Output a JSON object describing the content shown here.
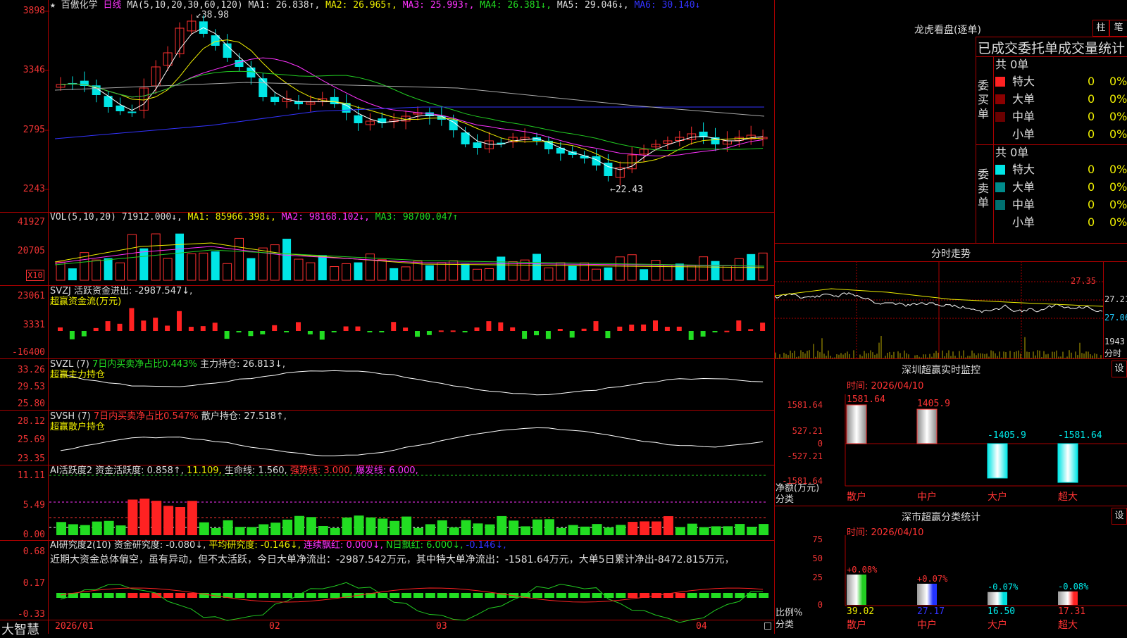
{
  "stock": {
    "star": "★",
    "name": "百傲化学",
    "period": "日线"
  },
  "colors": {
    "up": "#ff3030",
    "down": "#00e5e5",
    "vol_up": "#ff3030",
    "vol_down": "#00e5e5"
  },
  "ma_header": {
    "label": "MA(5,10,20,30,60,120)",
    "ma1": "MA1: 26.838↑,",
    "ma2": "MA2: 26.965↑,",
    "ma3": "MA3: 25.993↑,",
    "ma4": "MA4: 26.381↓,",
    "ma5": "MA5: 29.046↓,",
    "ma6": "MA6: 30.140↓"
  },
  "main_axis": [
    "3898",
    "3346",
    "2795",
    "2243"
  ],
  "annot": {
    "high": "38.98",
    "low": "22.43"
  },
  "vol": {
    "header_label": "VOL(5,10,20)",
    "value": "71912.000↓,",
    "ma1": "MA1: 85966.398↓,",
    "ma2": "MA2: 98168.102↓,",
    "ma3": "MA3: 98700.047↑",
    "axis": [
      "41927",
      "20705"
    ],
    "unit": "X10"
  },
  "svzj": {
    "header": "SVZJ  活跃资金进出: -2987.547↓,",
    "sub": "超赢资金流(万元)",
    "axis": [
      "23061",
      "3331",
      "-16400"
    ]
  },
  "svzl": {
    "header_a": "SVZL (7)",
    "header_b": "7日内买卖净占比0.443%",
    "header_c": "主力持仓: 26.813↓,",
    "sub": "超赢主力持仓",
    "axis": [
      "33.26",
      "29.53",
      "25.80"
    ]
  },
  "svsh": {
    "header_a": "SVSH (7)",
    "header_b": "7日内买卖净占比0.547%",
    "header_c": "散户持仓: 27.518↑,",
    "sub": "超赢散户持仓",
    "axis": [
      "28.12",
      "25.69",
      "23.35"
    ]
  },
  "ai1": {
    "header_a": "AI活跃度2",
    "header_b": "资金活跃度: 0.858↑,",
    "header_c": "11.109,",
    "header_d": "生命线: 1.560,",
    "header_e": "强势线: 3.000,",
    "header_f": "爆发线: 6.000,",
    "axis": [
      "11.11",
      "5.49",
      "0.00"
    ]
  },
  "ai2": {
    "header_a": "AI研究度2(10)",
    "header_b": "资金研究度: -0.080↓,",
    "header_c": "平均研究度: -0.146↓,",
    "header_d": "连续飘红: 0.000↓,",
    "header_e": "N日飘红: 6.000↓,",
    "header_f": "-0.146↓,",
    "comment": "近期大资金总体偏空，虽有异动，但不太活跃，今日大单净流出：-2987.542万元，其中特大单净流出：-1581.64万元，大单5日累计净出-8472.815万元，",
    "axis": [
      "0.68",
      "0.17",
      "-0.33"
    ]
  },
  "time_axis": [
    "2026/01",
    "02",
    "03",
    "04"
  ],
  "footer": {
    "brand": "大智慧"
  },
  "right": {
    "title": "龙虎看盘(逐单)",
    "btn_bar": "柱",
    "btn_pen": "笔",
    "stat_title": "已成交委托单成交量统计",
    "buy": {
      "label": "委买单",
      "total": "共 0单",
      "rows": [
        {
          "name": "特大",
          "v": "0",
          "p": "0%"
        },
        {
          "name": "大单",
          "v": "0",
          "p": "0%"
        },
        {
          "name": "中单",
          "v": "0",
          "p": "0%"
        },
        {
          "name": "小单",
          "v": "0",
          "p": "0%"
        }
      ]
    },
    "sell": {
      "label": "委卖单",
      "total": "共 0单",
      "rows": [
        {
          "name": "特大",
          "v": "0",
          "p": "0%"
        },
        {
          "name": "大单",
          "v": "0",
          "p": "0%"
        },
        {
          "name": "中单",
          "v": "0",
          "p": "0%"
        },
        {
          "name": "小单",
          "v": "0",
          "p": "0%"
        }
      ]
    },
    "intraday": {
      "title": "分时走势",
      "axis": [
        "27.35",
        "27.21",
        "27.06",
        "1943",
        "分时"
      ]
    },
    "monitor": {
      "title": "深圳超赢实时监控",
      "btn": "设",
      "time": "时间: 2026/04/10",
      "ylabel": "净额(万元)",
      "xlabel": "分类",
      "axis": [
        "1581.64",
        "527.21",
        "0",
        "-527.21",
        "-1581.64"
      ],
      "bars": [
        {
          "cat": "散户",
          "value": 1581.64,
          "label": "1581.64"
        },
        {
          "cat": "中户",
          "value": 1405.9,
          "label": "1405.9"
        },
        {
          "cat": "大户",
          "value": -1405.9,
          "label": "-1405.9"
        },
        {
          "cat": "超大",
          "value": -1581.64,
          "label": "-1581.64"
        }
      ]
    },
    "classify": {
      "title": "深市超赢分类统计",
      "btn": "设",
      "time": "时间: 2026/04/10",
      "ylabel": "比例%",
      "xlabel": "分类",
      "axis": [
        "75",
        "50",
        "25",
        "0"
      ],
      "bars": [
        {
          "cat": "散户",
          "value": 39.02,
          "pct": "+0.08%",
          "color": "#22cc22"
        },
        {
          "cat": "中户",
          "value": 27.17,
          "pct": "+0.07%",
          "color": "#2233ff"
        },
        {
          "cat": "大户",
          "value": 16.5,
          "pct": "-0.07%",
          "color": "#00dddd"
        },
        {
          "cat": "超大",
          "value": 17.31,
          "pct": "-0.08%",
          "color": "#ff2222"
        }
      ],
      "values": [
        "39.02",
        "27.17",
        "16.50",
        "17.31"
      ]
    }
  }
}
